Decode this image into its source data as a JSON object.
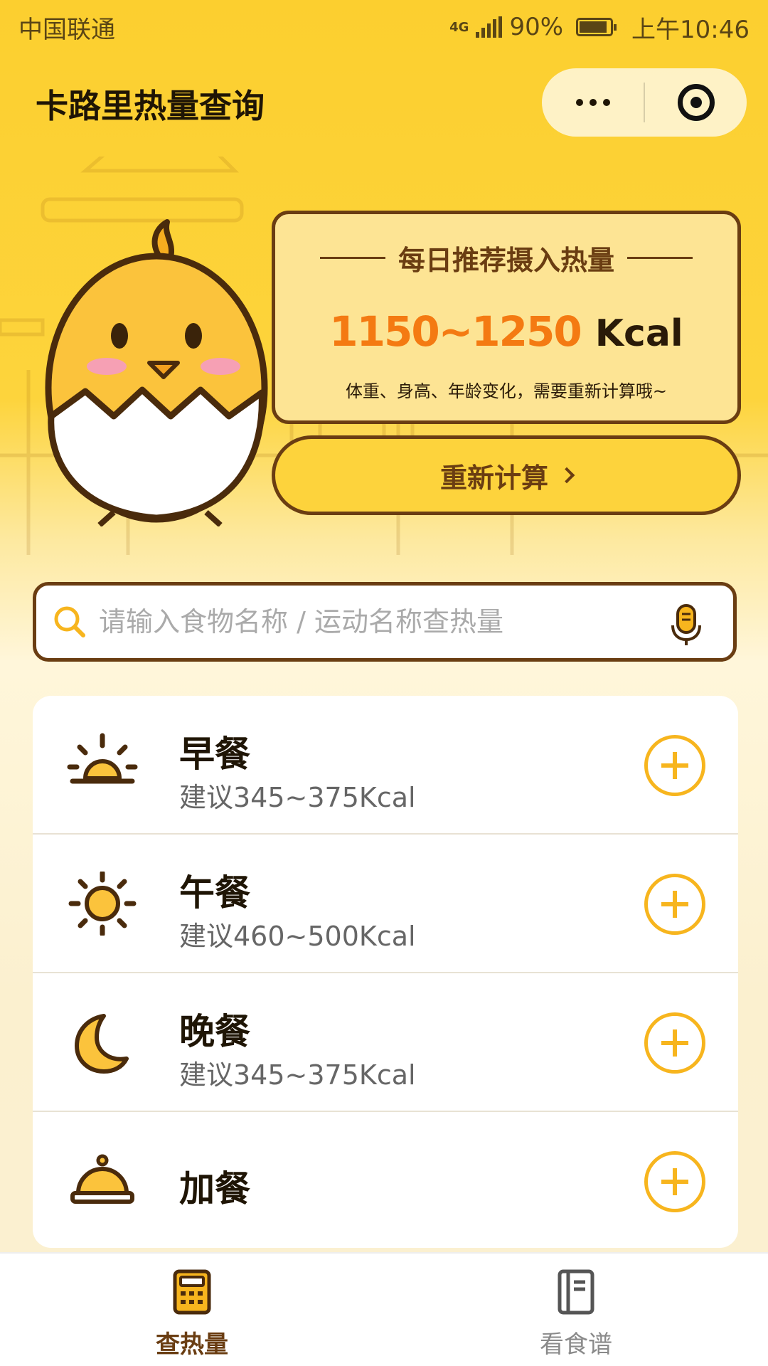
{
  "status_bar": {
    "carrier": "中国联通",
    "network": "4G",
    "battery": "90%",
    "battery_level": 0.9,
    "time": "上午10:46"
  },
  "header": {
    "title": "卡路里热量查询",
    "more_icon": "more-dots-icon",
    "close_icon": "target-circle-icon"
  },
  "intake_card": {
    "heading": "每日推荐摄入热量",
    "range": "1150~1250",
    "unit": "Kcal",
    "note": "体重、身高、年龄变化，需要重新计算哦~"
  },
  "recalc": {
    "label": "重新计算"
  },
  "search": {
    "placeholder": "请输入食物名称 / 运动名称查热量"
  },
  "meals": [
    {
      "icon": "sunrise-icon",
      "name": "早餐",
      "suggestion": "建议345~375Kcal"
    },
    {
      "icon": "sun-icon",
      "name": "午餐",
      "suggestion": "建议460~500Kcal"
    },
    {
      "icon": "moon-icon",
      "name": "晚餐",
      "suggestion": "建议345~375Kcal"
    },
    {
      "icon": "food-cloche-icon",
      "name": "加餐",
      "suggestion": ""
    }
  ],
  "tabs": [
    {
      "label": "查热量",
      "icon": "calculator-icon",
      "active": true
    },
    {
      "label": "看食谱",
      "icon": "recipe-book-icon",
      "active": false
    }
  ],
  "colors": {
    "brand_yellow": "#fccf2f",
    "brown": "#6a3d12",
    "accent_orange": "#f47a12",
    "add_button": "#f7b51e"
  }
}
